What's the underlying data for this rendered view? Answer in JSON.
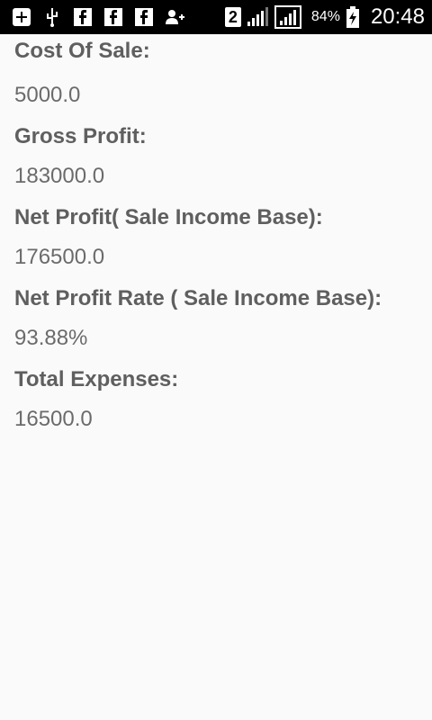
{
  "status_bar": {
    "icons_left": [
      "add-box-icon",
      "usb-icon",
      "facebook-icon",
      "facebook-icon",
      "facebook-icon",
      "person-add-icon"
    ],
    "sim_badge": "2",
    "battery_percent": "84%",
    "time": "20:48"
  },
  "report": {
    "cost_of_sale_label": "Cost Of Sale:",
    "cost_of_sale_value": "5000.0",
    "gross_profit_label": "Gross Profit:",
    "gross_profit_value": "183000.0",
    "net_profit_label": "Net Profit( Sale Income Base):",
    "net_profit_value": "176500.0",
    "net_profit_rate_label": "Net Profit Rate ( Sale Income Base):",
    "net_profit_rate_value": "93.88%",
    "total_expenses_label": "Total Expenses:",
    "total_expenses_value": "16500.0"
  },
  "colors": {
    "statusbar_bg": "#000000",
    "page_bg": "#fafafa",
    "label_text": "#5f5f5f",
    "value_text": "#6b6b6b"
  }
}
